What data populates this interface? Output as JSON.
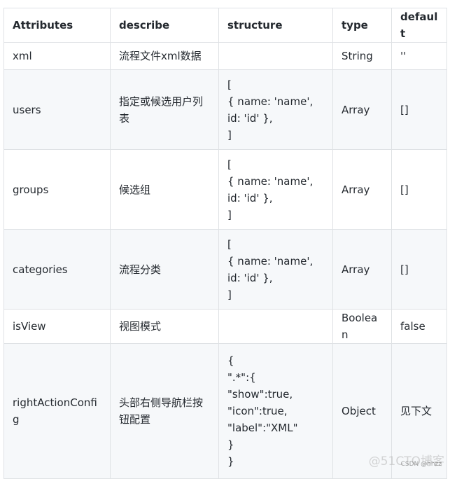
{
  "table": {
    "headers": [
      "Attributes",
      "describe",
      "structure",
      "type",
      "default"
    ],
    "rows": [
      {
        "attribute": "xml",
        "describe": "流程文件xml数据",
        "structure": [],
        "type": "String",
        "default": "''"
      },
      {
        "attribute": "users",
        "describe": "指定或候选用户列表",
        "structure": [
          "[",
          "{ name: 'name', id: 'id' },",
          "]"
        ],
        "type": "Array",
        "default": "[]"
      },
      {
        "attribute": "groups",
        "describe": "候选组",
        "structure": [
          "[",
          "{ name: 'name', id: 'id' },",
          "]"
        ],
        "type": "Array",
        "default": "[]"
      },
      {
        "attribute": "categories",
        "describe": "流程分类",
        "structure": [
          "[",
          "{ name: 'name', id: 'id' },",
          "]"
        ],
        "type": "Array",
        "default": "[]"
      },
      {
        "attribute": "isView",
        "describe": "视图模式",
        "structure": [],
        "type": "Boolean",
        "default": "false"
      },
      {
        "attribute": "rightActionConfig",
        "describe": "头部右侧导航栏按钮配置",
        "structure": [
          "{",
          "\".*\":{",
          "\"show\":true,",
          "\"icon\":true,",
          "\"label\":\"XML\"",
          "}",
          "}"
        ],
        "type": "Object",
        "default": "见下文"
      }
    ]
  },
  "watermark": {
    "primary": "@51CTO博客",
    "secondary": "CSDN @hhzz"
  }
}
